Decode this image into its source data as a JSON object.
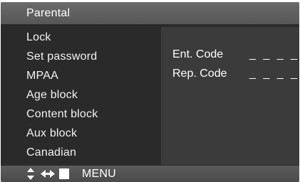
{
  "header": {
    "title": "Parental"
  },
  "menu": {
    "items": [
      {
        "label": "Lock"
      },
      {
        "label": "Set password"
      },
      {
        "label": "MPAA"
      },
      {
        "label": "Age block"
      },
      {
        "label": "Content block"
      },
      {
        "label": "Aux block"
      },
      {
        "label": "Canadian"
      }
    ]
  },
  "panel": {
    "entry_label": "Ent. Code",
    "entry_value": "_ _ _ _",
    "repeat_label": "Rep. Code",
    "repeat_value": "_ _ _ _"
  },
  "footer": {
    "icons": [
      "updown-arrow-icon",
      "leftright-arrow-icon",
      "stop-square-icon"
    ],
    "menu_label": "MENU"
  }
}
